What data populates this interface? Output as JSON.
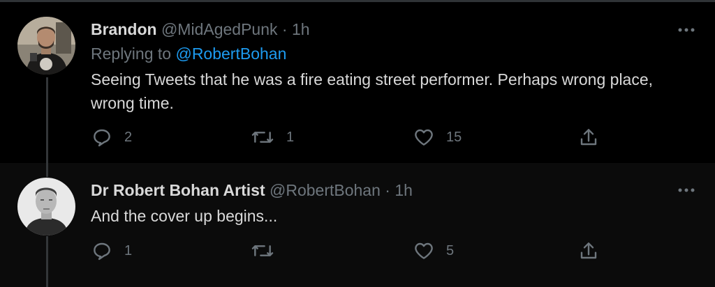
{
  "tweets": [
    {
      "name": "Brandon",
      "handle": "@MidAgedPunk",
      "separator": "·",
      "time": "1h",
      "replying_prefix": "Replying to",
      "replying_to": "@RobertBohan",
      "text": "Seeing Tweets that he was a fire eating street performer. Perhaps wrong place, wrong time.",
      "actions": {
        "reply": "2",
        "retweet": "1",
        "like": "15"
      }
    },
    {
      "name": "Dr Robert Bohan Artist",
      "handle": "@RobertBohan",
      "separator": "·",
      "time": "1h",
      "text": "And the cover up begins...",
      "actions": {
        "reply": "1",
        "retweet": "",
        "like": "5"
      }
    }
  ],
  "icons": {
    "reply": "reply-icon",
    "retweet": "retweet-icon",
    "like": "heart-icon",
    "share": "share-icon",
    "more": "more-icon"
  },
  "colors": {
    "background": "#000000",
    "text": "#d9d9d9",
    "muted": "#6e767d",
    "link": "#1d9bf0"
  }
}
